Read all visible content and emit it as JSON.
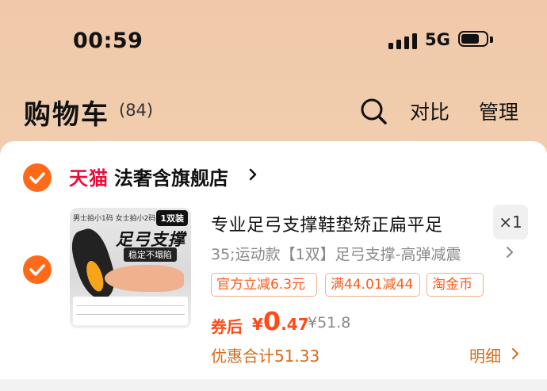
{
  "status_bar": {
    "time": "00:59",
    "network": "5G",
    "battery_level": 0.75
  },
  "header": {
    "title": "购物车",
    "count": "(84)",
    "compare_label": "对比",
    "manage_label": "管理"
  },
  "store": {
    "brand": "天猫",
    "name": "法奢含旗舰店"
  },
  "product": {
    "image_text": {
      "top_note": "男士拍小1码 女士拍小2码",
      "pill": "1双装",
      "main": "足弓支撑",
      "sub": "稳定不塌陷"
    },
    "title": "专业足弓支撑鞋垫矫正扁平足",
    "quantity": "×1",
    "spec": "35;运动款【1双】足弓支撑-高弹减震",
    "tags": [
      "官方立减6.3元",
      "满44.01减44",
      "淘金币"
    ],
    "price_label": "券后",
    "price_symbol": "¥",
    "price_int": "0",
    "price_dec": ".47",
    "original_price": "¥51.8",
    "discount_total": "优惠合计51.33",
    "detail_label": "明细"
  },
  "colors": {
    "accent": "#ff6a1a",
    "tmall_red": "#e8103a",
    "header_bg": "#f0c9a8"
  }
}
